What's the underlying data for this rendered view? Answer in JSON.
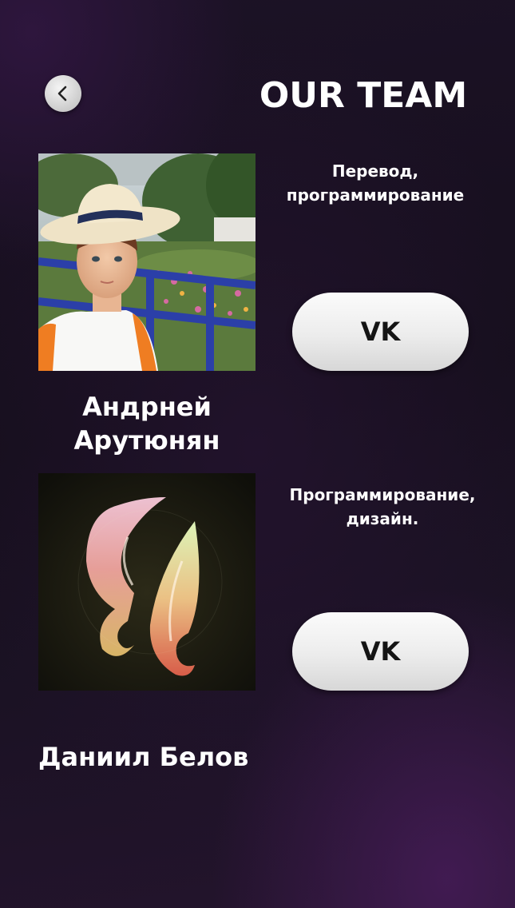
{
  "header": {
    "back_icon": "chevron-left-icon",
    "title": "OUR TEAM"
  },
  "members": [
    {
      "name": "Андрней\nАрутюнян",
      "role": "Перевод,\nпрограммирование",
      "link_label": "VK",
      "photo": "boy-in-straw-hat-photo"
    },
    {
      "name": "Даниил Белов",
      "role": "Программирование,\nдизайн.",
      "link_label": "VK",
      "photo": "glowing-pony-mane-logo"
    }
  ],
  "colors": {
    "background": "#1a1222",
    "button": "#ececec",
    "button_text": "#141414",
    "text": "#ffffff"
  }
}
